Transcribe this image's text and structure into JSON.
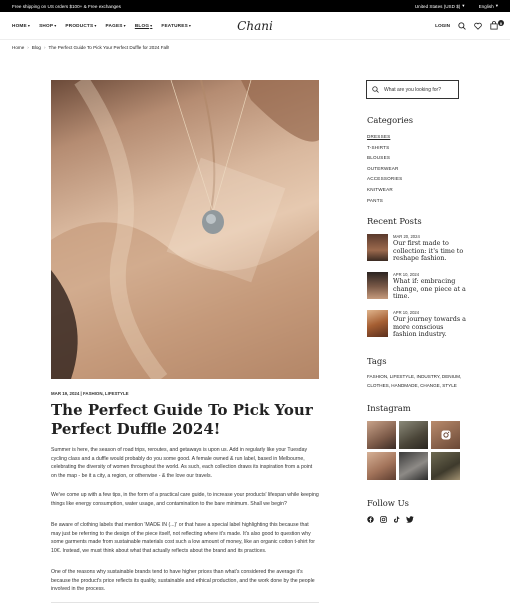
{
  "topbar": {
    "announcement": "Free shipping on US orders $100+ & Free exchanges",
    "region": "United States (USD $)",
    "language": "English"
  },
  "header": {
    "nav": [
      {
        "label": "HOME"
      },
      {
        "label": "SHOP"
      },
      {
        "label": "PRODUCTS"
      },
      {
        "label": "PAGES"
      },
      {
        "label": "BLOG"
      },
      {
        "label": "FEATURES"
      }
    ],
    "logo": "Chani",
    "login": "LOGIN",
    "cart_count": "0"
  },
  "breadcrumb": {
    "home": "Home",
    "blog": "Blog",
    "current": "The Perfect Guide To Pick Your Perfect Duffle for 2024 Fall!"
  },
  "article": {
    "meta": "MAR 19, 2024  |  FASHION, LIFESTYLE",
    "title": "The Perfect Guide To Pick Your Perfect Duffle 2024!",
    "paragraphs": [
      "Summer is here, the season of road trips, reroutes, and getaways is upon us. Add in regularly like your Tuesday cycling class and a duffle would probably do you some good. A female owned & run label, based in Melbourne, celebrating the diversity of women throughout the world. As such, each collection draws its inspiration from a point on the map - be it a city, a region, or otherwise - & the love our travels.",
      "We've come up with a few tips, in the form of a practical care guide, to increase your products' lifespan while keeping things like energy consumption, water usage, and contamination to the bare minimum. Shall we begin?",
      "Be aware of clothing labels that mention 'MADE IN (...)' or that have a special label highlighting this because that may just be referring to the design of the piece itself, not reflecting where it's made. It's also good to question why some garments made from sustainable materials cost such a low amount of money, like an organic cotton t-shirt for 10€. Instead, we must think about what that actually reflects about the brand and its practices.",
      "One of the reasons why sustainable brands tend to have higher prices than what's considered the average it's because the product's price reflects its quality, sustainable and ethical production, and the work done by the people involved in the process."
    ]
  },
  "sidebar": {
    "search_placeholder": "What are you looking for?",
    "categories_heading": "Categories",
    "categories": [
      "DRESSES",
      "T-SHIRTS",
      "BLOUSES",
      "OUTERWEAR",
      "ACCESSORIES",
      "KNITWEAR",
      "PANTS"
    ],
    "recent_heading": "Recent Posts",
    "recent_posts": [
      {
        "date": "MAR 20, 2024",
        "title": "Our first made to collection: it's time to reshape fashion."
      },
      {
        "date": "APR 10, 2024",
        "title": "What if: embracing change, one piece at a time."
      },
      {
        "date": "APR 10, 2024",
        "title": "Our journey towards a more conscious fashion industry."
      }
    ],
    "tags_heading": "Tags",
    "tags": "FASHION, LIFESTYLE, INDUSTRY, DENIUM, CLOTHES, HANDMADE, CHANGE, STYLE",
    "instagram_heading": "Instagram",
    "follow_heading": "Follow Us"
  },
  "colors": {
    "accent": "#222222",
    "topbar": "#000000"
  }
}
